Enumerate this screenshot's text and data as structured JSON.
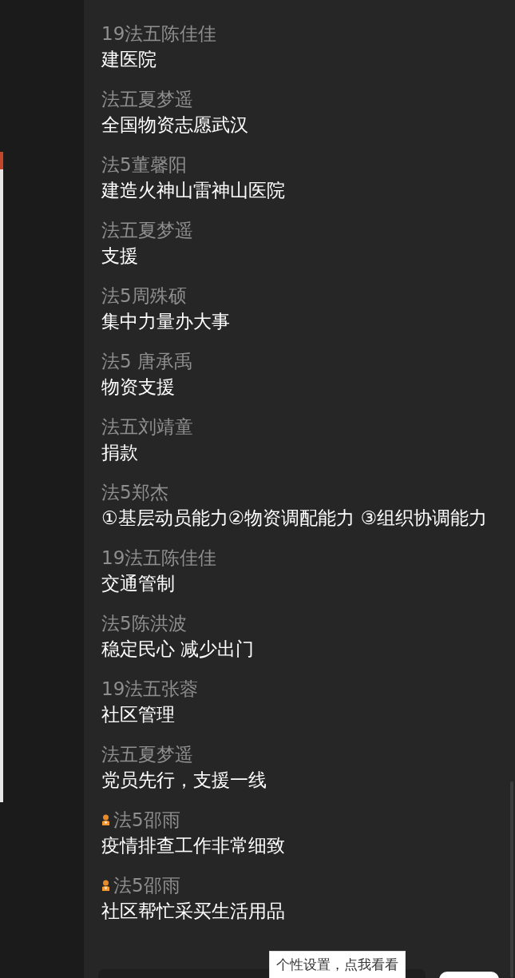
{
  "messages": [
    {
      "sender": "19法五陈佳佳",
      "text": "建医院",
      "badge": false
    },
    {
      "sender": "法五夏梦遥",
      "text": "全国物资志愿武汉",
      "badge": false
    },
    {
      "sender": "法5董馨阳",
      "text": "建造火神山雷神山医院",
      "badge": false
    },
    {
      "sender": "法五夏梦遥",
      "text": "支援",
      "badge": false
    },
    {
      "sender": "法5周殊硕",
      "text": "集中力量办大事",
      "badge": false
    },
    {
      "sender": "法5 唐承禹",
      "text": "物资支援",
      "badge": false
    },
    {
      "sender": "法五刘靖童",
      "text": "捐款",
      "badge": false
    },
    {
      "sender": "法5郑杰",
      "text": "①基层动员能力②物资调配能力 ③组织协调能力",
      "badge": false
    },
    {
      "sender": "19法五陈佳佳",
      "text": "交通管制",
      "badge": false
    },
    {
      "sender": "法5陈洪波",
      "text": "稳定民心 减少出门",
      "badge": false
    },
    {
      "sender": "19法五张蓉",
      "text": "社区管理",
      "badge": false
    },
    {
      "sender": "法五夏梦遥",
      "text": "党员先行，支援一线",
      "badge": false
    },
    {
      "sender": "法5邵雨",
      "text": "疫情排查工作非常细致",
      "badge": true
    },
    {
      "sender": "法5邵雨",
      "text": "社区帮忙采买生活用品",
      "badge": true
    }
  ],
  "tooltip": "个性设置，点我看看"
}
